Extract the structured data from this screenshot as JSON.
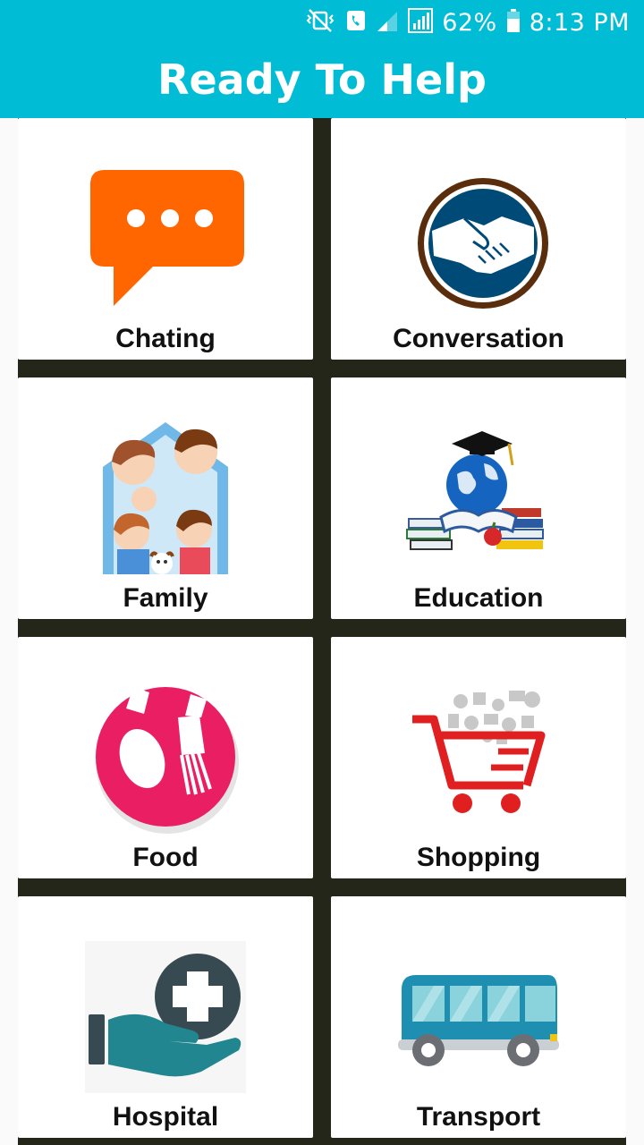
{
  "status_bar": {
    "battery": "62%",
    "time": "8:13 PM",
    "icons": [
      "vibrate-mute-icon",
      "call-icon",
      "signal-weak-icon",
      "signal-full-icon",
      "battery-icon"
    ]
  },
  "app_bar": {
    "title": "Ready To Help"
  },
  "categories": [
    {
      "label": "Chating",
      "icon": "chat-bubble-icon",
      "color": "#ff6600"
    },
    {
      "label": "Conversation",
      "icon": "handshake-icon",
      "color": "#004a77"
    },
    {
      "label": "Family",
      "icon": "family-icon",
      "color": "#6fb8e8"
    },
    {
      "label": "Education",
      "icon": "graduation-globe-icon",
      "color": "#1565c0"
    },
    {
      "label": "Food",
      "icon": "spoon-fork-icon",
      "color": "#e91e63"
    },
    {
      "label": "Shopping",
      "icon": "shopping-cart-icon",
      "color": "#e53935"
    },
    {
      "label": "Hospital",
      "icon": "hospital-hand-icon",
      "color": "#21868f"
    },
    {
      "label": "Transport",
      "icon": "bus-icon",
      "color": "#1e8fb0"
    }
  ]
}
